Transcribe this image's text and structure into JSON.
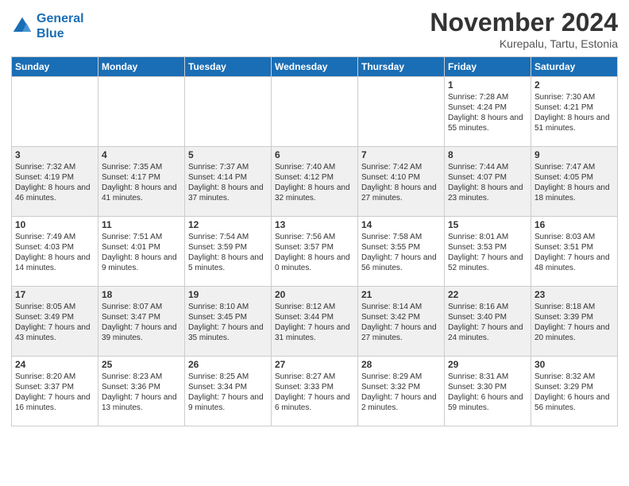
{
  "header": {
    "logo_line1": "General",
    "logo_line2": "Blue",
    "month": "November 2024",
    "location": "Kurepalu, Tartu, Estonia"
  },
  "weekdays": [
    "Sunday",
    "Monday",
    "Tuesday",
    "Wednesday",
    "Thursday",
    "Friday",
    "Saturday"
  ],
  "weeks": [
    [
      {
        "day": "",
        "info": ""
      },
      {
        "day": "",
        "info": ""
      },
      {
        "day": "",
        "info": ""
      },
      {
        "day": "",
        "info": ""
      },
      {
        "day": "",
        "info": ""
      },
      {
        "day": "1",
        "info": "Sunrise: 7:28 AM\nSunset: 4:24 PM\nDaylight: 8 hours and 55 minutes."
      },
      {
        "day": "2",
        "info": "Sunrise: 7:30 AM\nSunset: 4:21 PM\nDaylight: 8 hours and 51 minutes."
      }
    ],
    [
      {
        "day": "3",
        "info": "Sunrise: 7:32 AM\nSunset: 4:19 PM\nDaylight: 8 hours and 46 minutes."
      },
      {
        "day": "4",
        "info": "Sunrise: 7:35 AM\nSunset: 4:17 PM\nDaylight: 8 hours and 41 minutes."
      },
      {
        "day": "5",
        "info": "Sunrise: 7:37 AM\nSunset: 4:14 PM\nDaylight: 8 hours and 37 minutes."
      },
      {
        "day": "6",
        "info": "Sunrise: 7:40 AM\nSunset: 4:12 PM\nDaylight: 8 hours and 32 minutes."
      },
      {
        "day": "7",
        "info": "Sunrise: 7:42 AM\nSunset: 4:10 PM\nDaylight: 8 hours and 27 minutes."
      },
      {
        "day": "8",
        "info": "Sunrise: 7:44 AM\nSunset: 4:07 PM\nDaylight: 8 hours and 23 minutes."
      },
      {
        "day": "9",
        "info": "Sunrise: 7:47 AM\nSunset: 4:05 PM\nDaylight: 8 hours and 18 minutes."
      }
    ],
    [
      {
        "day": "10",
        "info": "Sunrise: 7:49 AM\nSunset: 4:03 PM\nDaylight: 8 hours and 14 minutes."
      },
      {
        "day": "11",
        "info": "Sunrise: 7:51 AM\nSunset: 4:01 PM\nDaylight: 8 hours and 9 minutes."
      },
      {
        "day": "12",
        "info": "Sunrise: 7:54 AM\nSunset: 3:59 PM\nDaylight: 8 hours and 5 minutes."
      },
      {
        "day": "13",
        "info": "Sunrise: 7:56 AM\nSunset: 3:57 PM\nDaylight: 8 hours and 0 minutes."
      },
      {
        "day": "14",
        "info": "Sunrise: 7:58 AM\nSunset: 3:55 PM\nDaylight: 7 hours and 56 minutes."
      },
      {
        "day": "15",
        "info": "Sunrise: 8:01 AM\nSunset: 3:53 PM\nDaylight: 7 hours and 52 minutes."
      },
      {
        "day": "16",
        "info": "Sunrise: 8:03 AM\nSunset: 3:51 PM\nDaylight: 7 hours and 48 minutes."
      }
    ],
    [
      {
        "day": "17",
        "info": "Sunrise: 8:05 AM\nSunset: 3:49 PM\nDaylight: 7 hours and 43 minutes."
      },
      {
        "day": "18",
        "info": "Sunrise: 8:07 AM\nSunset: 3:47 PM\nDaylight: 7 hours and 39 minutes."
      },
      {
        "day": "19",
        "info": "Sunrise: 8:10 AM\nSunset: 3:45 PM\nDaylight: 7 hours and 35 minutes."
      },
      {
        "day": "20",
        "info": "Sunrise: 8:12 AM\nSunset: 3:44 PM\nDaylight: 7 hours and 31 minutes."
      },
      {
        "day": "21",
        "info": "Sunrise: 8:14 AM\nSunset: 3:42 PM\nDaylight: 7 hours and 27 minutes."
      },
      {
        "day": "22",
        "info": "Sunrise: 8:16 AM\nSunset: 3:40 PM\nDaylight: 7 hours and 24 minutes."
      },
      {
        "day": "23",
        "info": "Sunrise: 8:18 AM\nSunset: 3:39 PM\nDaylight: 7 hours and 20 minutes."
      }
    ],
    [
      {
        "day": "24",
        "info": "Sunrise: 8:20 AM\nSunset: 3:37 PM\nDaylight: 7 hours and 16 minutes."
      },
      {
        "day": "25",
        "info": "Sunrise: 8:23 AM\nSunset: 3:36 PM\nDaylight: 7 hours and 13 minutes."
      },
      {
        "day": "26",
        "info": "Sunrise: 8:25 AM\nSunset: 3:34 PM\nDaylight: 7 hours and 9 minutes."
      },
      {
        "day": "27",
        "info": "Sunrise: 8:27 AM\nSunset: 3:33 PM\nDaylight: 7 hours and 6 minutes."
      },
      {
        "day": "28",
        "info": "Sunrise: 8:29 AM\nSunset: 3:32 PM\nDaylight: 7 hours and 2 minutes."
      },
      {
        "day": "29",
        "info": "Sunrise: 8:31 AM\nSunset: 3:30 PM\nDaylight: 6 hours and 59 minutes."
      },
      {
        "day": "30",
        "info": "Sunrise: 8:32 AM\nSunset: 3:29 PM\nDaylight: 6 hours and 56 minutes."
      }
    ]
  ]
}
